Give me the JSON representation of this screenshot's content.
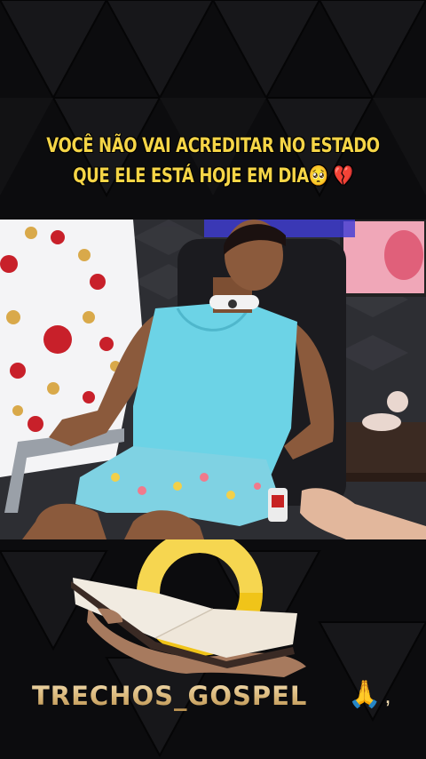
{
  "caption": {
    "line1": "VOCÊ NÃO VAI ACREDITAR NO ESTADO",
    "line2": "QUE ELE ESTÁ HOJE EM DIA",
    "emoji_pleading": "🥺",
    "emoji_broken_heart": "💔"
  },
  "brand": {
    "name": "TRECHOS_GOSPEL",
    "emoji_praying": "🙏",
    "suffix": ","
  },
  "colors": {
    "caption_text": "#f5d547",
    "ring_gold": "#f0c419",
    "shirt": "#6cd3e6"
  },
  "icons": [
    "pleading-face-icon",
    "broken-heart-icon",
    "praying-hands-icon",
    "gold-ring-logo-icon",
    "open-book-icon"
  ]
}
